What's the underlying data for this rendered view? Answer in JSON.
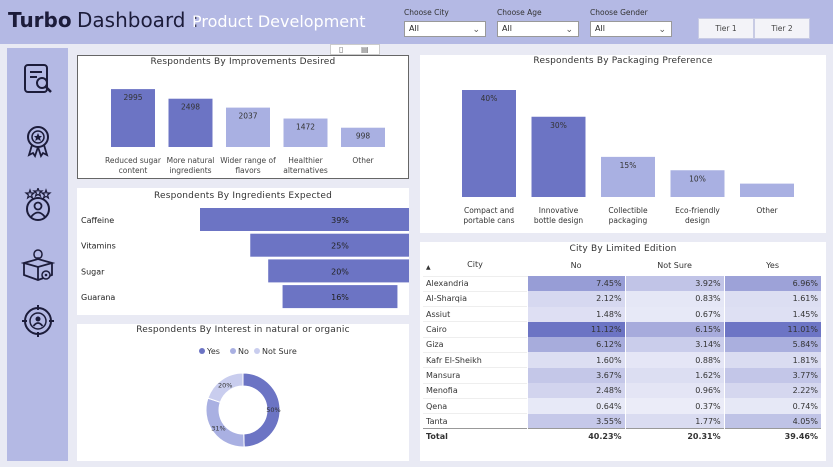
{
  "header": {
    "brand": "Turbo",
    "title": "Dashboard :",
    "subtitle": "Product Development",
    "filters": [
      {
        "label": "Choose City",
        "value": "All"
      },
      {
        "label": "Choose Age",
        "value": "All"
      },
      {
        "label": "Choose Gender",
        "value": "All"
      }
    ],
    "tiers": [
      "Tier 1",
      "Tier 2"
    ]
  },
  "sidebar": {
    "icons": [
      "report-search-icon",
      "award-badge-icon",
      "rated-user-icon",
      "product-box-icon",
      "target-user-icon"
    ]
  },
  "colors": {
    "accent": "#6c74c4",
    "light": "#a9b0e2",
    "header": "#b4b9e4"
  },
  "improvements": {
    "title": "Respondents By Improvements Desired",
    "chart_data": {
      "type": "bar",
      "categories": [
        "Reduced sugar content",
        "More natural ingredients",
        "Wider range of flavors",
        "Healthier alternatives",
        "Other"
      ],
      "cat_lines": [
        [
          "Reduced sugar",
          "content"
        ],
        [
          "More natural",
          "ingredients"
        ],
        [
          "Wider range of",
          "flavors"
        ],
        [
          "Healthier",
          "alternatives"
        ],
        [
          "Other"
        ]
      ],
      "values": [
        2995,
        2498,
        2037,
        1472,
        998
      ],
      "labels": [
        "2995",
        "2498",
        "2037",
        "1472",
        "998"
      ]
    }
  },
  "packaging": {
    "title": "Respondents By Packaging Preference",
    "chart_data": {
      "type": "bar",
      "categories": [
        "Compact and portable cans",
        "Innovative bottle design",
        "Collectible packaging",
        "Eco-friendly design",
        "Other"
      ],
      "cat_lines": [
        [
          "Compact and",
          "portable cans"
        ],
        [
          "Innovative",
          "bottle design"
        ],
        [
          "Collectible",
          "packaging"
        ],
        [
          "Eco-friendly",
          "design"
        ],
        [
          "Other"
        ]
      ],
      "values": [
        40,
        30,
        15,
        10,
        5
      ],
      "labels": [
        "40%",
        "30%",
        "15%",
        "10%",
        ""
      ]
    }
  },
  "ingredients": {
    "title": "Respondents By Ingredients Expected",
    "chart_data": {
      "type": "bar",
      "categories": [
        "Caffeine",
        "Vitamins",
        "Sugar",
        "Guarana"
      ],
      "values": [
        39,
        25,
        20,
        16
      ],
      "labels": [
        "39%",
        "25%",
        "20%",
        "16%"
      ]
    }
  },
  "interest": {
    "title": "Respondents By Interest in natural or organic",
    "chart_data": {
      "type": "pie",
      "legend": [
        "Yes",
        "No",
        "Not Sure"
      ],
      "values": [
        50,
        31,
        20
      ],
      "labels": [
        "50%",
        "31%",
        "20%"
      ]
    }
  },
  "city_table": {
    "title": "City By Limited Edition",
    "columns": [
      "City",
      "No",
      "Not Sure",
      "Yes"
    ],
    "rows": [
      [
        "Alexandria",
        "7.45%",
        "3.92%",
        "6.96%"
      ],
      [
        "Al-Sharqia",
        "2.12%",
        "0.83%",
        "1.61%"
      ],
      [
        "Assiut",
        "1.48%",
        "0.67%",
        "1.45%"
      ],
      [
        "Cairo",
        "11.12%",
        "6.15%",
        "11.01%"
      ],
      [
        "Giza",
        "6.12%",
        "3.14%",
        "5.84%"
      ],
      [
        "Kafr El-Sheikh",
        "1.60%",
        "0.88%",
        "1.81%"
      ],
      [
        "Mansura",
        "3.67%",
        "1.62%",
        "3.77%"
      ],
      [
        "Menofia",
        "2.48%",
        "0.96%",
        "2.22%"
      ],
      [
        "Qena",
        "0.64%",
        "0.37%",
        "0.74%"
      ],
      [
        "Tanta",
        "3.55%",
        "1.77%",
        "4.05%"
      ]
    ],
    "total": [
      "Total",
      "40.23%",
      "20.31%",
      "39.46%"
    ]
  }
}
